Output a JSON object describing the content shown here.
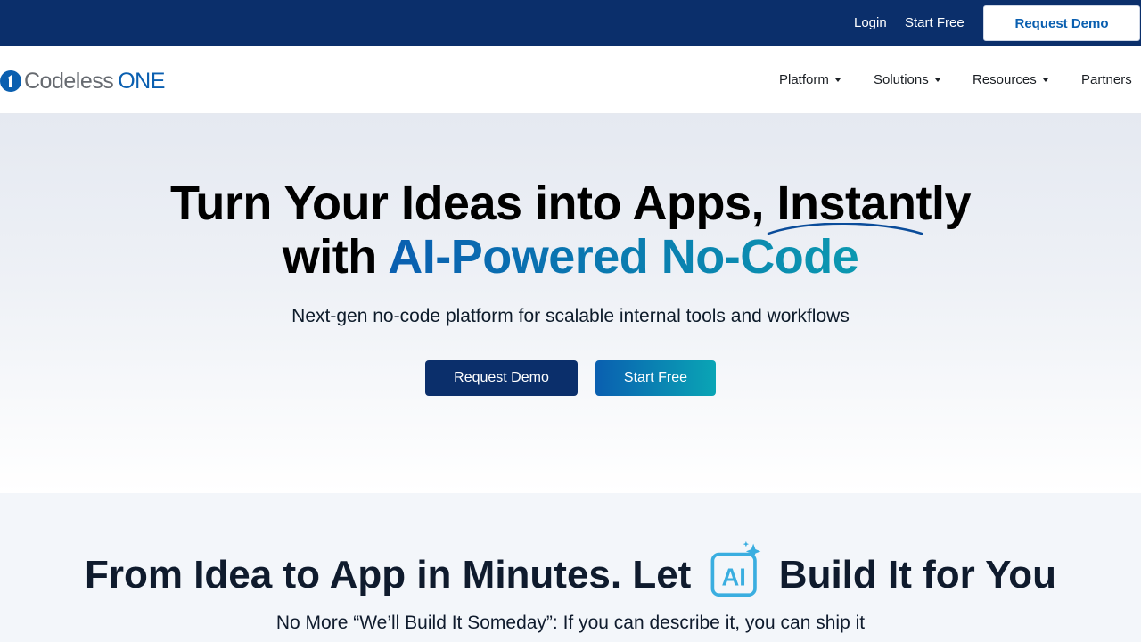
{
  "topbar": {
    "login": "Login",
    "start_free": "Start Free",
    "request_demo": "Request Demo",
    "background": "#0b2f6b"
  },
  "nav": {
    "logo_word1": "Codeless",
    "logo_word2": "ONE",
    "items": [
      {
        "label": "Platform",
        "has_dropdown": true
      },
      {
        "label": "Solutions",
        "has_dropdown": true
      },
      {
        "label": "Resources",
        "has_dropdown": true
      },
      {
        "label": "Partners",
        "has_dropdown": false
      }
    ]
  },
  "hero": {
    "title_line1": "Turn Your Ideas into Apps, Instantly",
    "title_line2_prefix": "with ",
    "title_line2_accent": "AI-Powered No-Code",
    "subtitle": "Next-gen no-code platform for scalable internal tools and workflows",
    "primary_button": "Request Demo",
    "secondary_button": "Start Free",
    "accent_colors": [
      "#0a5fb0",
      "#0aa5b5"
    ]
  },
  "section2": {
    "title_before": "From Idea to App in Minutes. Let ",
    "badge_icon": "ai-sparkle-icon",
    "badge_text": "AI",
    "title_after": " Build It for You",
    "subtitle": "No More “We’ll Build It Someday”: If you can describe it, you can ship it"
  }
}
